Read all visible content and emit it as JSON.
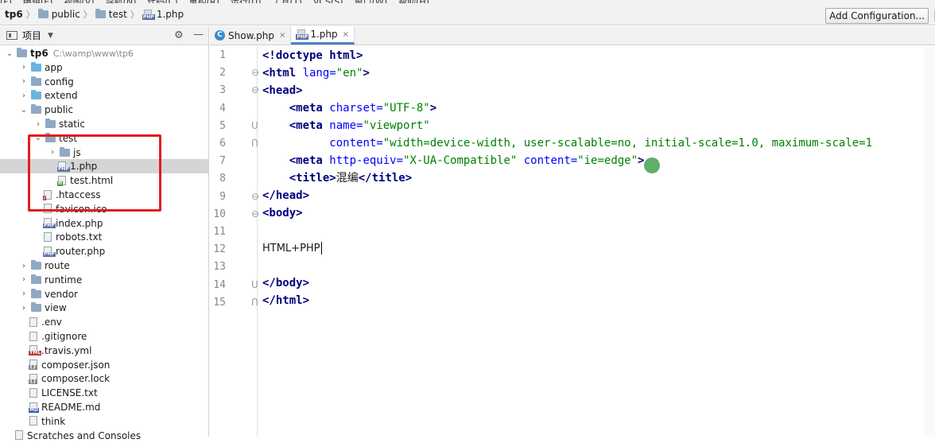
{
  "menubar": {
    "items": [
      "(F)",
      "编辑(E)",
      "视图(V)",
      "导航(N)",
      "代码(C)",
      "重构(R)",
      "运行(U)",
      "工具(T)",
      "VCS(S)",
      "窗口(W)",
      "帮助(H)"
    ]
  },
  "breadcrumb": [
    "tp6",
    "public",
    "test",
    "1.php"
  ],
  "toolbar": {
    "add_configuration": "Add Configuration..."
  },
  "panel": {
    "title": "项目",
    "gear": "⚙",
    "minimize": "—"
  },
  "tree": [
    {
      "label": "tp6",
      "path": "C:\\wamp\\www\\tp6",
      "type": "root",
      "expanded": true,
      "bold": true
    },
    {
      "label": "app",
      "type": "folder-blue"
    },
    {
      "label": "config",
      "type": "folder"
    },
    {
      "label": "extend",
      "type": "folder-blue"
    },
    {
      "label": "public",
      "type": "folder",
      "expanded": true
    },
    {
      "label": "static",
      "type": "folder"
    },
    {
      "label": "test",
      "type": "folder",
      "expanded": true
    },
    {
      "label": "js",
      "type": "folder"
    },
    {
      "label": "1.php",
      "type": "php",
      "selected": true
    },
    {
      "label": "test.html",
      "type": "html"
    },
    {
      "label": ".htaccess",
      "type": "htaccess"
    },
    {
      "label": "favicon.ico",
      "type": "file"
    },
    {
      "label": "index.php",
      "type": "php"
    },
    {
      "label": "robots.txt",
      "type": "file"
    },
    {
      "label": "router.php",
      "type": "php"
    },
    {
      "label": "route",
      "type": "folder"
    },
    {
      "label": "runtime",
      "type": "folder"
    },
    {
      "label": "vendor",
      "type": "folder"
    },
    {
      "label": "view",
      "type": "folder"
    },
    {
      "label": ".env",
      "type": "file"
    },
    {
      "label": ".gitignore",
      "type": "file"
    },
    {
      "label": ".travis.yml",
      "type": "yml"
    },
    {
      "label": "composer.json",
      "type": "json"
    },
    {
      "label": "composer.lock",
      "type": "json"
    },
    {
      "label": "LICENSE.txt",
      "type": "file"
    },
    {
      "label": "README.md",
      "type": "md"
    },
    {
      "label": "think",
      "type": "file"
    },
    {
      "label": "Scratches and Consoles",
      "type": "scratch"
    }
  ],
  "tabs": [
    {
      "label": "Show.php",
      "icon": "c-icon",
      "active": false
    },
    {
      "label": "1.php",
      "icon": "php-icon",
      "active": true
    }
  ],
  "tab_close": "×",
  "line_numbers": [
    "1",
    "2",
    "3",
    "4",
    "5",
    "6",
    "7",
    "8",
    "9",
    "10",
    "11",
    "12",
    "13",
    "14",
    "15"
  ],
  "code": {
    "l1": [
      "<!doctype ",
      "html",
      ">"
    ],
    "l2": [
      "<html ",
      "lang=",
      "\"en\"",
      ">"
    ],
    "l3": [
      "<head>"
    ],
    "l4": [
      "<meta ",
      "charset=",
      "\"UTF-8\"",
      ">"
    ],
    "l5": [
      "<meta ",
      "name=",
      "\"viewport\""
    ],
    "l6": [
      "content=",
      "\"width=device-width, user-scalable=no, initial-scale=1.0, maximum-scale=1"
    ],
    "l7": [
      "<meta ",
      "http-equiv=",
      "\"X-UA-Compatible\"",
      " content=",
      "\"ie=edge\"",
      ">"
    ],
    "l8": [
      "<title>",
      "混编",
      "</title>"
    ],
    "l9": [
      "</head>"
    ],
    "l10": [
      "<body>"
    ],
    "l12": "HTML+PHP",
    "l14": [
      "</body>"
    ],
    "l15": [
      "</html>"
    ]
  }
}
